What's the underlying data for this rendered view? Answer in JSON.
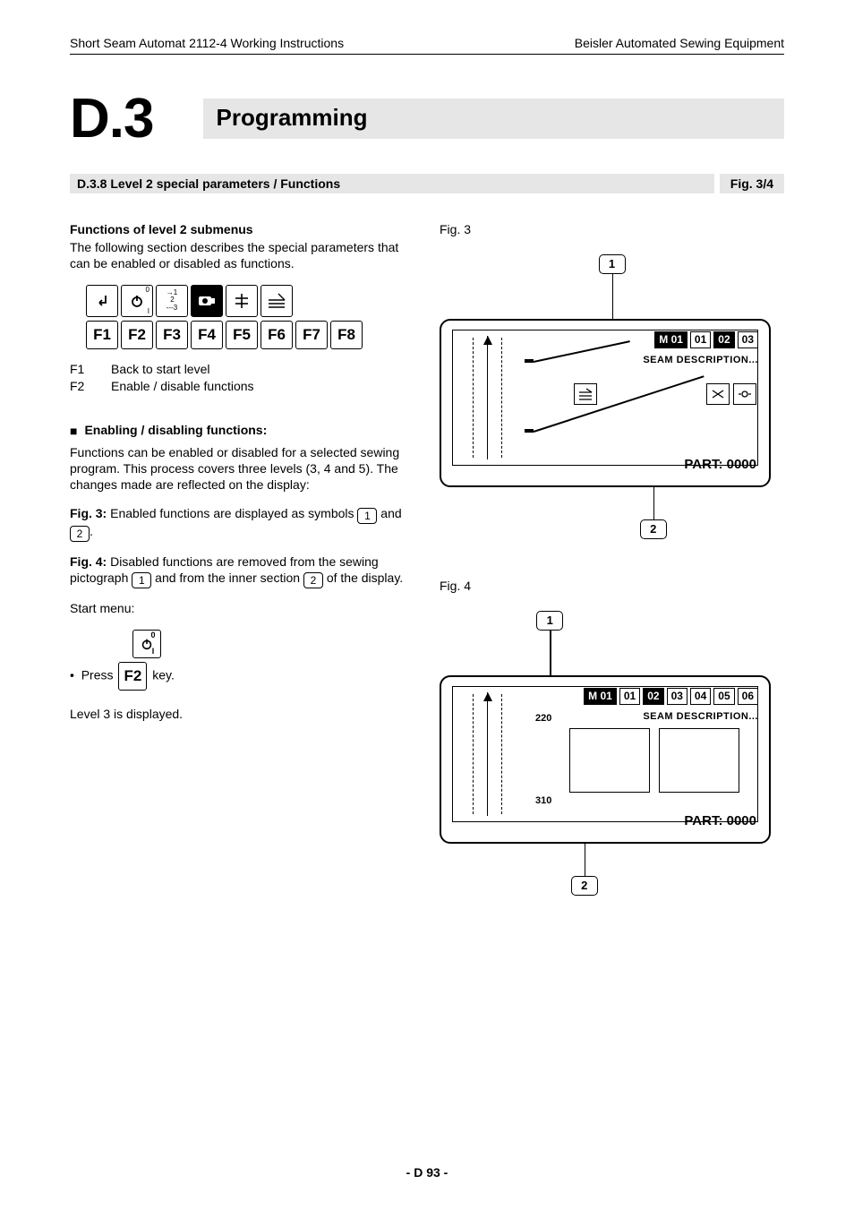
{
  "header": {
    "left": "Short Seam Automat  2112-4 Working Instructions",
    "right": "Beisler Automated Sewing Equipment"
  },
  "section": {
    "number": "D.3",
    "title": "Programming"
  },
  "subsection": {
    "label": "D.3.8 Level 2 special parameters / Functions",
    "figref": "Fig. 3/4"
  },
  "left": {
    "h1": "Functions of level 2 submenus",
    "p1": "The following section describes the special parameters that can be enabled or disabled as functions.",
    "fkeys": [
      "F1",
      "F2",
      "F3",
      "F4",
      "F5",
      "F6",
      "F7",
      "F8"
    ],
    "defs": [
      {
        "k": "F1",
        "v": "Back to start level"
      },
      {
        "k": "F2",
        "v": "Enable / disable functions"
      }
    ],
    "h2": "Enabling / disabling functions:",
    "p2": "Functions can be enabled or disabled for a selected sewing program. This process covers three levels (3, 4 and 5). The changes made are reflected on the display:",
    "p3a": "Fig. 3:",
    "p3b": " Enabled functions are displayed as symbols ",
    "p3c": " and ",
    "p3d": ".",
    "p4a": "Fig. 4:",
    "p4b": " Disabled functions are removed from the sewing pictograph ",
    "p4c": " and from the inner section ",
    "p4d": " of the display.",
    "startmenu": "Start menu:",
    "press_a": "Press ",
    "press_key": "F2",
    "press_b": " key.",
    "level3": "Level 3 is displayed."
  },
  "fig3": {
    "label": "Fig. 3",
    "c1": "1",
    "c2": "2",
    "m": "M 01",
    "tabs": [
      "01",
      "02",
      "03"
    ],
    "seam": "SEAM DESCRIPTION...",
    "part": "PART: 0000"
  },
  "fig4": {
    "label": "Fig. 4",
    "c1": "1",
    "c2": "2",
    "m": "M 01",
    "tabs": [
      "01",
      "02",
      "03",
      "04",
      "05",
      "06"
    ],
    "seam": "SEAM DESCRIPTION...",
    "n1": "220",
    "n2": "310",
    "part": "PART: 0000"
  },
  "footer": "- D 93 -"
}
